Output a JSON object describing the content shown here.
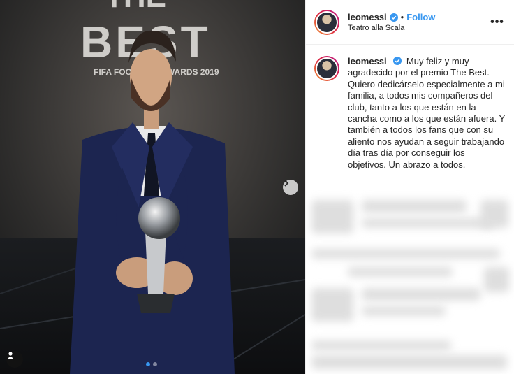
{
  "post": {
    "username": "leomessi",
    "separator": "•",
    "follow_label": "Follow",
    "location": "Teatro alla Scala",
    "more_label": "•••",
    "caption": "Muy feliz y muy agradecido por el premio The Best. Quiero dedicárselo especialmente a mi familia, a todos mis compañeros del club, tanto a los que están en la cancha como a los que están afuera. Y también a todos los fans que con su aliento nos ayudan a seguir trabajando día tras día por conseguir los objetivos. Un abrazo a todos."
  },
  "photo": {
    "backdrop_text_line1": "THE",
    "backdrop_text_line2": "BEST",
    "backdrop_text_line3": "FIFA FOOTBALL AWARDS 2019"
  },
  "carousel": {
    "slides": 2,
    "active_index": 0
  },
  "colors": {
    "accent": "#3897f0",
    "text": "#262626",
    "border": "#efefef"
  }
}
